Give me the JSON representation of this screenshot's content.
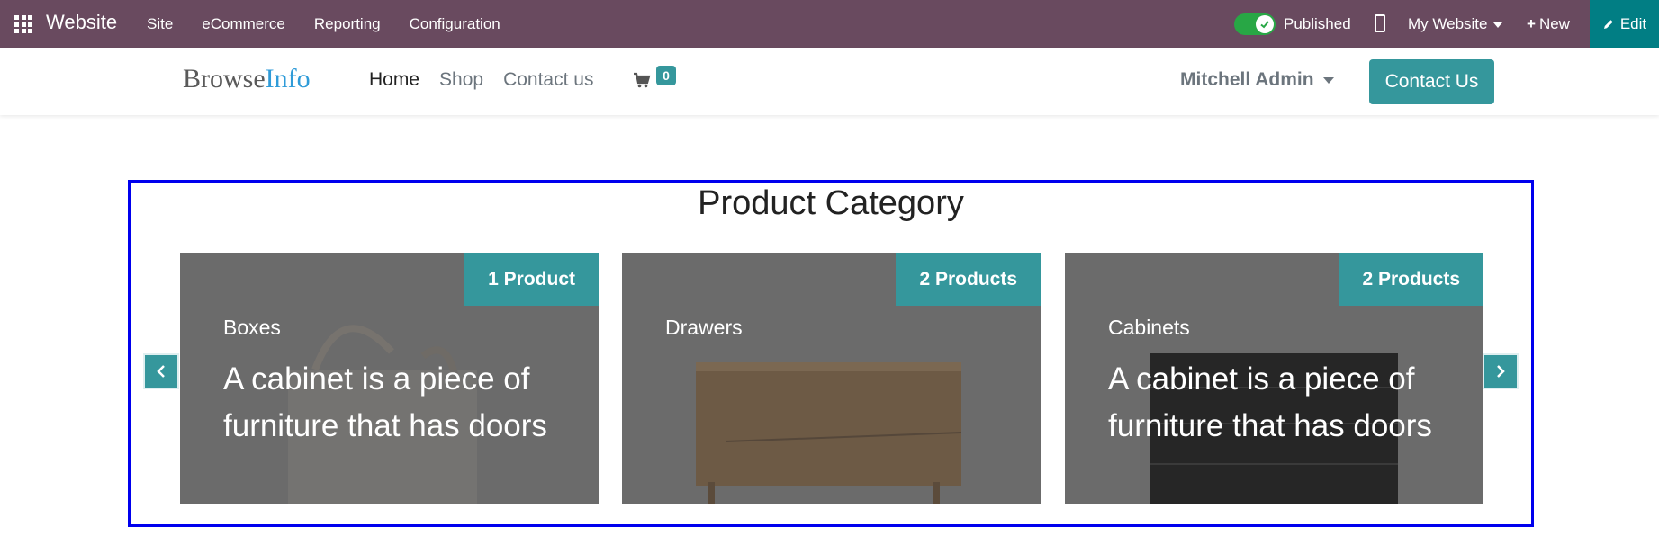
{
  "topbar": {
    "app_name": "Website",
    "menu": [
      "Site",
      "eCommerce",
      "Reporting",
      "Configuration"
    ],
    "published_label": "Published",
    "website_selector": "My Website",
    "new_label": "New",
    "edit_label": "Edit",
    "published_on": true
  },
  "header": {
    "logo_part1": "Browse",
    "logo_part2": "Info",
    "nav": [
      "Home",
      "Shop",
      "Contact us"
    ],
    "cart_count": "0",
    "user_name": "Mitchell Admin",
    "contact_button": "Contact Us"
  },
  "section": {
    "title": "Product Category",
    "cards": [
      {
        "badge": "1 Product",
        "name": "Boxes",
        "description": "A cabinet is a piece of furniture that has doors"
      },
      {
        "badge": "2 Products",
        "name": "Drawers",
        "description": ""
      },
      {
        "badge": "2 Products",
        "name": "Cabinets",
        "description": "A cabinet is a piece of furniture that has doors"
      }
    ]
  },
  "colors": {
    "topbar": "#694a5f",
    "accent": "#35979c",
    "edit": "#017e84",
    "card_overlay": "#6b6b6b",
    "selection_border": "#0000ee"
  }
}
